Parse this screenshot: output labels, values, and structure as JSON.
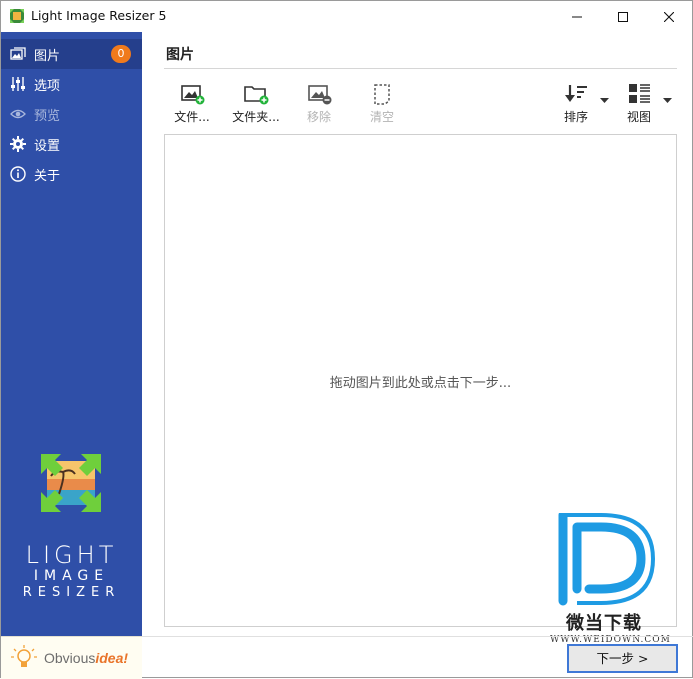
{
  "window": {
    "title": "Light Image Resizer 5",
    "icons": {
      "app": "app-logo-icon",
      "minimize": "minimize-icon",
      "maximize": "maximize-icon",
      "close": "close-icon"
    }
  },
  "sidebar": {
    "items": [
      {
        "label": "图片",
        "icon": "images-icon",
        "badge": "0",
        "active": true
      },
      {
        "label": "选项",
        "icon": "sliders-icon"
      },
      {
        "label": "预览",
        "icon": "eye-icon",
        "disabled": true
      },
      {
        "label": "设置",
        "icon": "gear-icon"
      },
      {
        "label": "关于",
        "icon": "info-icon"
      }
    ],
    "brand": {
      "line1": "LIGHT",
      "line2": "IMAGE",
      "line3": "RESIZER"
    },
    "vendor": {
      "part1": "Obvious",
      "part2": "idea!"
    },
    "colors": {
      "background": "#2f4fa8",
      "active": "#253f8c",
      "badge": "#f07a1c"
    }
  },
  "main": {
    "section_title": "图片",
    "toolbar": {
      "files": "文件...",
      "folder": "文件夹...",
      "remove": "移除",
      "clear": "清空",
      "sort": "排序",
      "view": "视图"
    },
    "drop_hint": "拖动图片到此处或点击下一步...",
    "next_button": "下一步 >"
  },
  "watermark": {
    "text": "微当下载",
    "url": "WWW.WEIDOWN.COM",
    "color": "#1e9be3"
  }
}
